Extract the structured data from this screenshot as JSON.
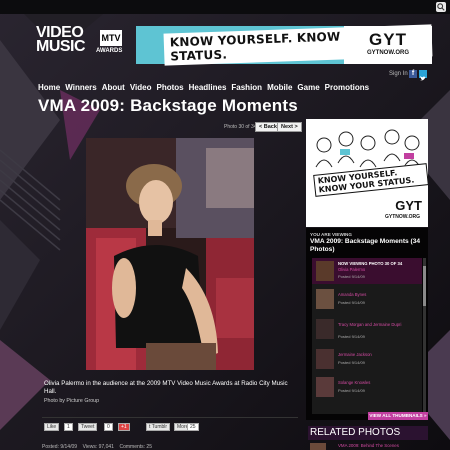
{
  "header": {
    "logo_line1": "VIDEO",
    "logo_line2": "MUSIC",
    "logo_mtv": "MTV",
    "logo_awards": "AWARDS",
    "banner_tagline": "KNOW YOURSELF. KNOW YOUR STATUS.",
    "banner_brand": "GYT",
    "banner_brand_url": "GYTNOW.ORG",
    "signin": "Sign In",
    "fb_icon": "f"
  },
  "nav": {
    "items": [
      "Home",
      "Winners",
      "About",
      "Video",
      "Photos",
      "Headlines",
      "Fashion",
      "Mobile",
      "Game",
      "Promotions"
    ]
  },
  "page": {
    "title": "VMA 2009: Backstage Moments",
    "pager_text": "Photo 30 of 34",
    "back_label": "< Back",
    "next_label": "Next >"
  },
  "photo": {
    "caption": "Olivia Palermo in the audience at the 2009 MTV Video Music Awards at Radio City Music Hall.",
    "credit": "Photo by Picture Group"
  },
  "share": {
    "like_label": "Like",
    "like_count": "1",
    "tweet_label": "Tweet",
    "tweet_count": "0",
    "plus_label": "+1",
    "tumblr_label": "t Tumblr",
    "more_label": "More",
    "more_count": "25"
  },
  "meta": {
    "posted": "Posted: 9/14/09",
    "views": "Views: 97,041",
    "comments": "Comments: 25"
  },
  "sidebar": {
    "ad_tagline": "KNOW YOURSELF. KNOW YOUR STATUS.",
    "ad_brand": "GYT",
    "ad_url": "GYTNOW.ORG",
    "viewing_label": "YOU ARE VIEWING",
    "viewing_title": "VMA 2009: Backstage Moments (34 Photos)",
    "thumbs": [
      {
        "now": "NOW VIEWING PHOTO 30 OF 34",
        "title": "Olivia Palermo",
        "posted": "Posted 9/14/09"
      },
      {
        "now": "",
        "title": "Amanda Bynes",
        "posted": "Posted 9/14/09"
      },
      {
        "now": "",
        "title": "Tracy Morgan and Jermaine Dupri",
        "posted": "Posted 9/14/09"
      },
      {
        "now": "",
        "title": "Jermaine Jackson",
        "posted": "Posted 9/14/09"
      },
      {
        "now": "",
        "title": "Solange Knowles",
        "posted": "Posted 9/14/09"
      }
    ],
    "view_all_label": "VIEW ALL THUMBNAILS »",
    "related_header": "RELATED PHOTOS",
    "related_item": "VMA 2009: Behind The Scenes"
  },
  "colors": {
    "background": "#141216",
    "accent_pink": "#c23fa0",
    "banner_teal": "#5ec4d3"
  }
}
